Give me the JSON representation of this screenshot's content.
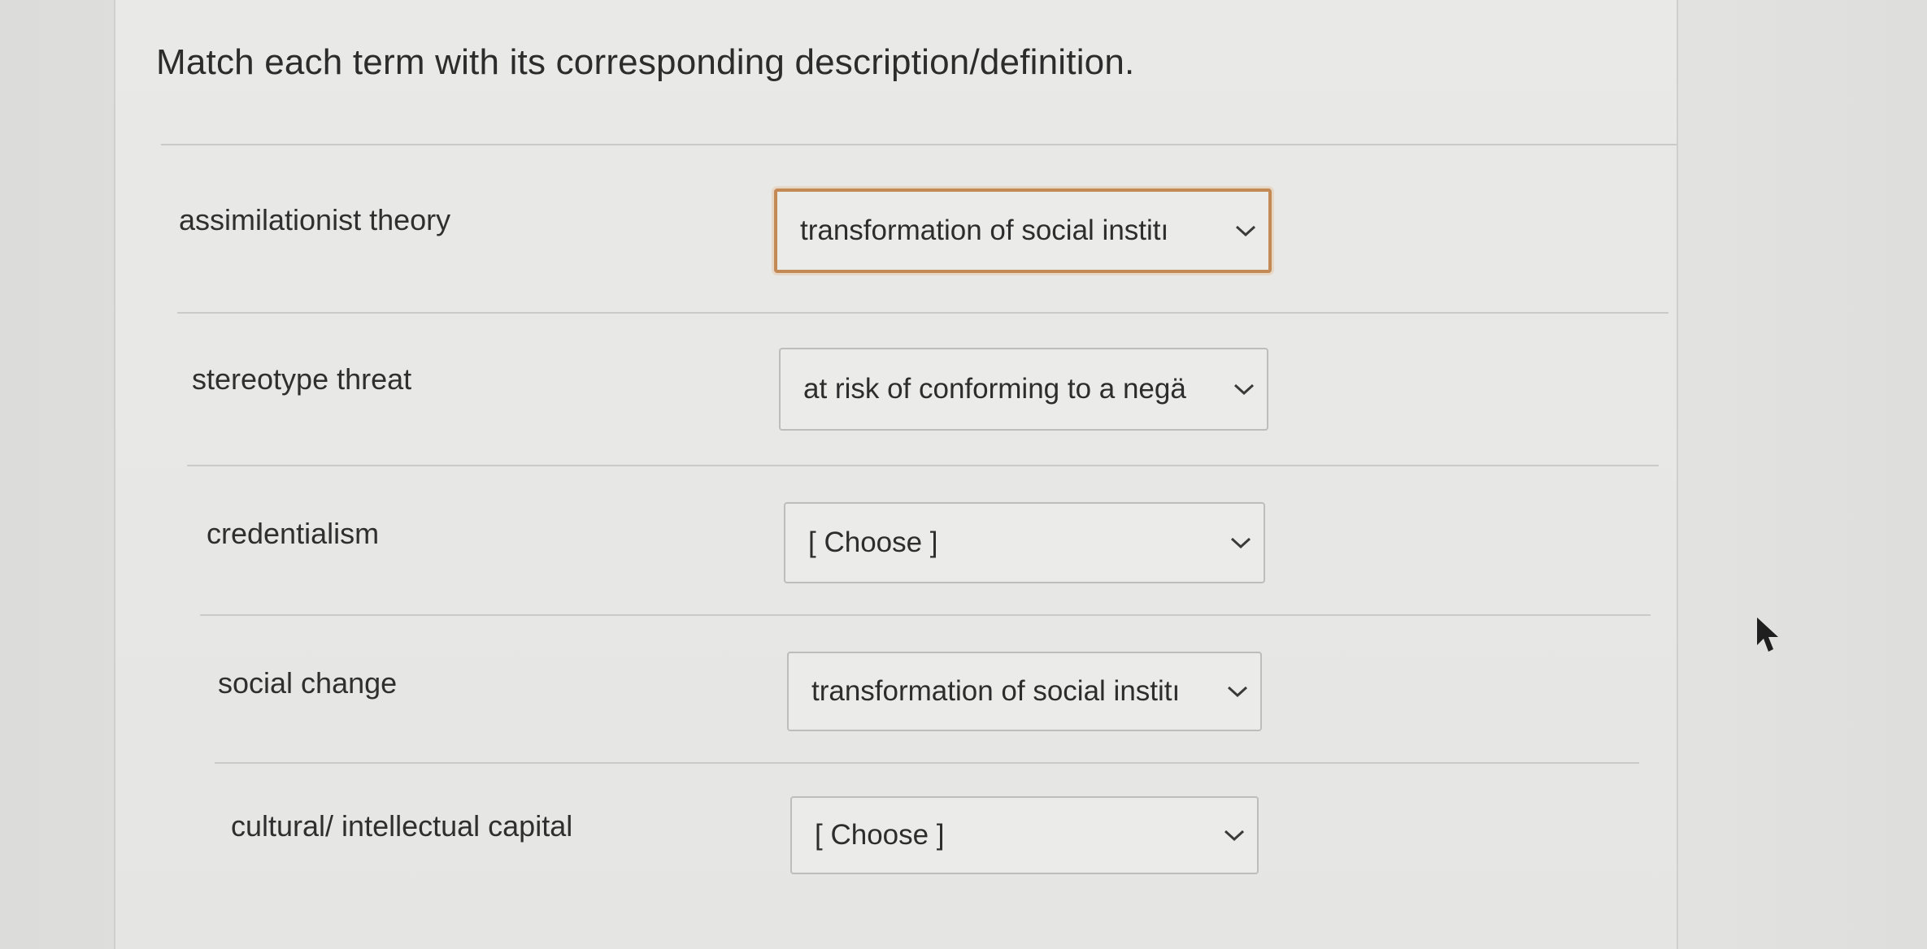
{
  "question": {
    "title": "Match each term with its corresponding description/definition."
  },
  "rows": [
    {
      "term": "assimilationist theory",
      "selected": "transformation of social institı",
      "focused": true
    },
    {
      "term": "stereotype threat",
      "selected": "at risk of conforming to a negä",
      "focused": false
    },
    {
      "term": "credentialism",
      "selected": "[ Choose ]",
      "focused": false
    },
    {
      "term": "social change",
      "selected": "transformation of social institı",
      "focused": false
    },
    {
      "term": "cultural/ intellectual capital",
      "selected": "[ Choose ]",
      "focused": false
    }
  ],
  "icons": {
    "dropdown": "chevron-down-icon",
    "cursor": "mouse-pointer-icon"
  },
  "colors": {
    "focus_border": "#c48a55",
    "text": "#2d2d2d"
  }
}
